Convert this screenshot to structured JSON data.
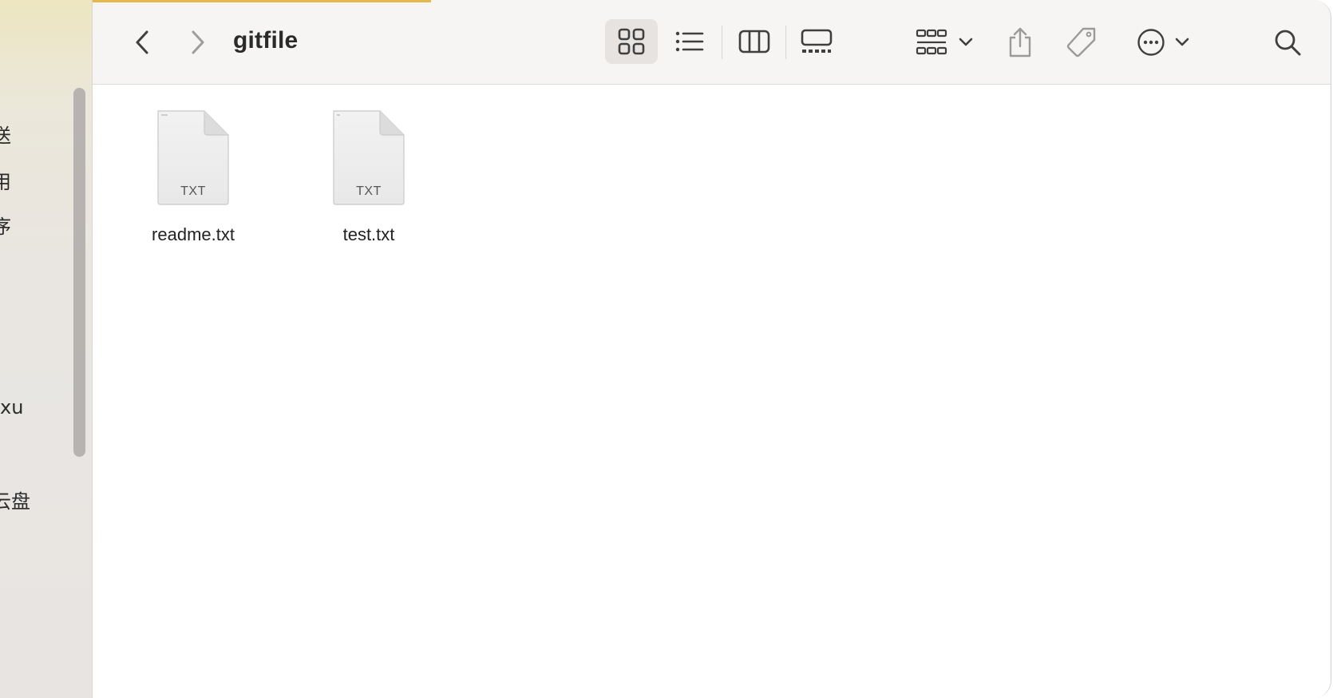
{
  "window": {
    "title": "gitfile"
  },
  "sidebar": {
    "items": [
      {
        "label": "送"
      },
      {
        "label": "用"
      },
      {
        "label": "序"
      },
      {
        "label": "xu"
      },
      {
        "label": "云盘"
      }
    ]
  },
  "toolbar": {
    "icons": {
      "back": "chevron-left-icon",
      "forward": "chevron-right-icon",
      "view_icon": "grid-view-icon",
      "view_list": "list-view-icon",
      "view_columns": "column-view-icon",
      "view_gallery": "gallery-view-icon",
      "group": "group-icon",
      "share": "share-icon",
      "tag": "tag-icon",
      "more": "ellipsis-circle-icon",
      "search": "search-icon"
    },
    "active_view": "icon"
  },
  "files": [
    {
      "name": "readme.txt",
      "ext": "TXT"
    },
    {
      "name": "test.txt",
      "ext": "TXT"
    }
  ],
  "colors": {
    "toolbar_bg": "#f7f5f3",
    "sidebar_bg": "#e9e6e2",
    "accent": "#e2b94a",
    "active_view_bg": "#e6e3e0"
  }
}
